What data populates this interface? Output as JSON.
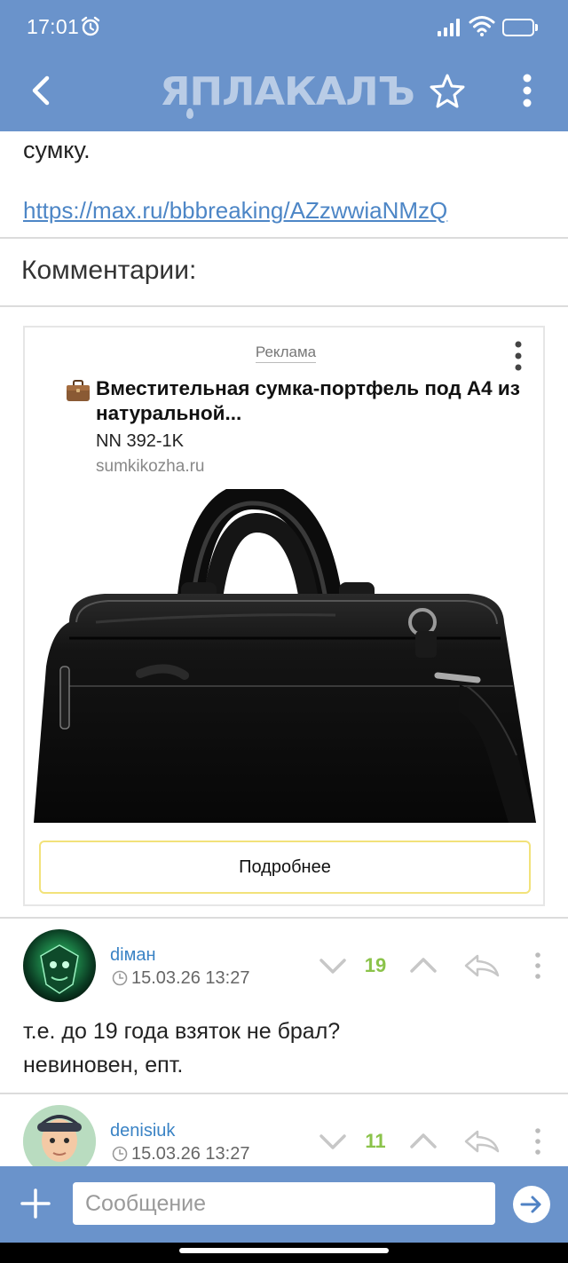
{
  "status_bar": {
    "time": "17:01",
    "battery": "93",
    "battery_level": 0.93
  },
  "nav": {
    "logo_text": "ЯПЛАКАЛЪ"
  },
  "post": {
    "tail_text": "сумку.",
    "link_text": "https://max.ru/bbbreaking/AZzwwiaNMzQ"
  },
  "comments_heading": "Комментарии:",
  "ad": {
    "label": "Реклама",
    "title": "Вместительная сумка-портфель под А4 из натуральной...",
    "subtitle": "NN 392-1K",
    "domain": "sumkikozha.ru",
    "cta": "Подробнее"
  },
  "comments": [
    {
      "author": "dіман",
      "time": "15.03.26 13:27",
      "score": "19",
      "text": "т.е. до 19 года взяток не брал?\nневиновен, епт."
    },
    {
      "author": "denisiuk",
      "time": "15.03.26 13:27",
      "score": "11"
    }
  ],
  "input": {
    "placeholder": "Сообщение"
  },
  "colors": {
    "header_bg": "#6a93cb",
    "link": "#4d86c6",
    "author": "#3a83c5",
    "score": "#8bc34a",
    "cta_border": "#f2e27a"
  }
}
